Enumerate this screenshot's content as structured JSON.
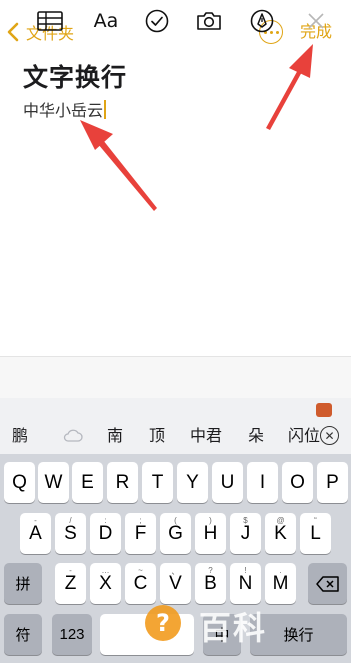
{
  "nav": {
    "back_label": "文件夹",
    "done_label": "完成"
  },
  "note": {
    "title": "文字换行",
    "line1": "中华小岳云"
  },
  "toolbar": {
    "items": [
      {
        "name": "table-icon"
      },
      {
        "name": "text-format",
        "label": "Aa"
      },
      {
        "name": "checklist-icon"
      },
      {
        "name": "camera-icon"
      },
      {
        "name": "markup-icon"
      },
      {
        "name": "close-icon"
      }
    ]
  },
  "candidates": {
    "words": [
      "鹏",
      "南",
      "顶",
      "中君",
      "朵",
      "闪位"
    ],
    "close_glyph": "✕"
  },
  "keyboard": {
    "row1": [
      {
        "key": "Q",
        "sub": ""
      },
      {
        "key": "W",
        "sub": ""
      },
      {
        "key": "E",
        "sub": ""
      },
      {
        "key": "R",
        "sub": ""
      },
      {
        "key": "T",
        "sub": ""
      },
      {
        "key": "Y",
        "sub": ""
      },
      {
        "key": "U",
        "sub": ""
      },
      {
        "key": "I",
        "sub": ""
      },
      {
        "key": "O",
        "sub": ""
      },
      {
        "key": "P",
        "sub": ""
      }
    ],
    "row2": [
      {
        "key": "A",
        "sub": "-"
      },
      {
        "key": "S",
        "sub": "/"
      },
      {
        "key": "D",
        "sub": ":"
      },
      {
        "key": "F",
        "sub": ";"
      },
      {
        "key": "G",
        "sub": "("
      },
      {
        "key": "H",
        "sub": ")"
      },
      {
        "key": "J",
        "sub": "$"
      },
      {
        "key": "K",
        "sub": "@"
      },
      {
        "key": "L",
        "sub": "“"
      }
    ],
    "row3": [
      {
        "key": "Z",
        "sub": "-"
      },
      {
        "key": "X",
        "sub": "…"
      },
      {
        "key": "C",
        "sub": "~"
      },
      {
        "key": "V",
        "sub": "、"
      },
      {
        "key": "B",
        "sub": "?"
      },
      {
        "key": "N",
        "sub": "!"
      },
      {
        "key": "M",
        "sub": "."
      }
    ],
    "pinyin_label": "拼",
    "symbol_label": "符",
    "num_label": "123",
    "space_label": "",
    "lang_label": "中",
    "return_label": "换行"
  },
  "watermark": {
    "text": "百科"
  },
  "colors": {
    "accent": "#e0a516",
    "arrow": "#e8413b"
  }
}
